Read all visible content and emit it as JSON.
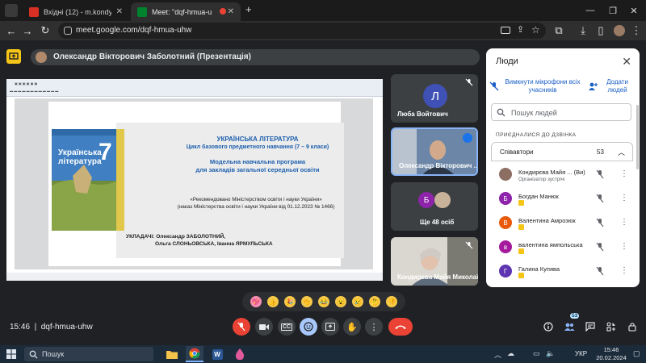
{
  "browser": {
    "tabs": [
      {
        "title": "Вхідні (12) - m.kondyrjeva@ips",
        "favicon_color": "#d93025",
        "active": false
      },
      {
        "title": "Meet: \"dqf-hmua-uhw\"",
        "favicon_color": "#00832d",
        "active": true
      }
    ],
    "new_tab": "+",
    "url": "meet.google.com/dqf-hmua-uhw"
  },
  "meet": {
    "presenter_label": "Олександр Вікторович Заболотний (Презентація)",
    "meeting_code": "dqf-hmua-uhw",
    "time": "15:46",
    "participant_badge_count": "53",
    "tiles": [
      {
        "initial": "Л",
        "name": "Люба Войтович",
        "avatar_color": "#3f51b5"
      },
      {
        "name": "Олександр Вікторович ..."
      },
      {
        "initials": [
          "Б"
        ],
        "name": "Ще 48 осіб"
      },
      {
        "name": "Кондирєва Майя Миколаївна"
      }
    ]
  },
  "slide": {
    "title": "УКРАЇНСЬКА ЛІТЕРАТУРА",
    "subtitle": "Цикл базового предметного навчання (7 – 9 класи)",
    "program_line1": "Модельна навчальна програма",
    "program_line2": "для закладів загальної середньої освіти",
    "recommended_line1": "«Рекомендовано Міністерством освіти і науки України»",
    "recommended_line2": "(наказ Міністерства освіти і науки України від 01.12.2023 № 1466)",
    "authors_label": "УКЛАДАЧІ: Олександр ЗАБОЛОТНИЙ,",
    "authors_line2": "Ольга СЛОНЬОВСЬКА, Іванна ЯРМУЛЬСЬКА",
    "book_title": "Українська література",
    "book_grade": "7"
  },
  "people_panel": {
    "title": "Люди",
    "mute_all": "Вимкнути мікрофони всіх учасників",
    "add_people": "Додати людей",
    "search_placeholder": "Пошук людей",
    "joined_label": "ПРИЄДНАЛИСЯ ДО ДЗВІНКА",
    "group_label": "Співавтори",
    "group_count": "53",
    "participants": [
      {
        "name": "Кондирєва Майя ...",
        "suffix": "(Ви)",
        "role": "Організатор зустрічі",
        "initial": "",
        "color": "#8d6e63"
      },
      {
        "name": "Богдан Манюк",
        "initial": "Б",
        "color": "#8e24aa"
      },
      {
        "name": "Валентина Амрозюк",
        "initial": "В",
        "color": "#e8590c"
      },
      {
        "name": "валентина ямпольська",
        "initial": "в",
        "color": "#a51a9d"
      },
      {
        "name": "Галина Купява",
        "initial": "Г",
        "color": "#5e35b1"
      }
    ]
  },
  "reactions": [
    "💖",
    "👍",
    "🎉",
    "👏",
    "😂",
    "😮",
    "😢",
    "🤔",
    "👎"
  ],
  "taskbar": {
    "search_label": "Пошук",
    "language": "УКР",
    "clock_time": "15:46",
    "clock_date": "20.02.2024"
  },
  "colors": {
    "meet_bg": "#202124",
    "end_call": "#ea4335",
    "accent_blue": "#1a5fc8",
    "slide_blue": "#1d5fae"
  }
}
